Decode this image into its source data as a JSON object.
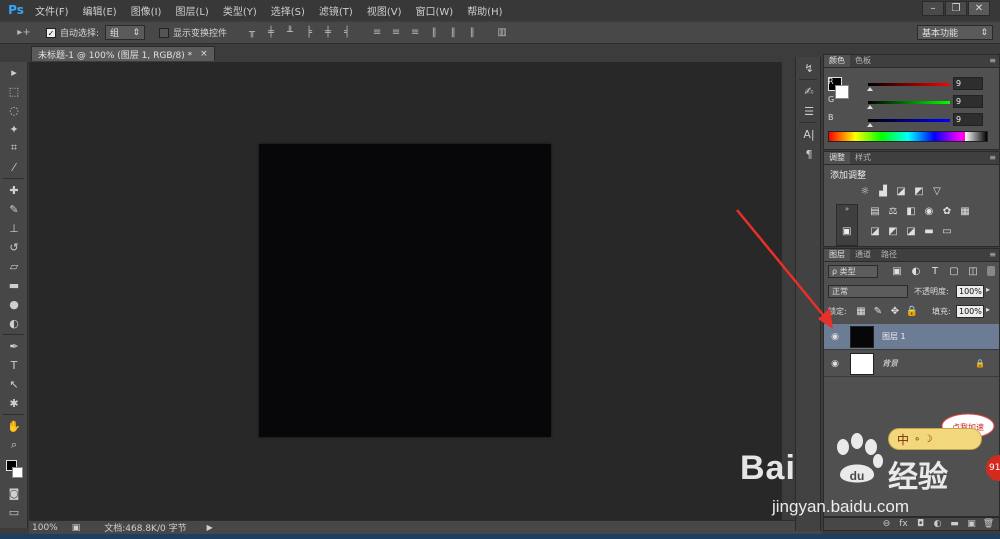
{
  "app": {
    "logo": "Ps"
  },
  "menu": [
    "文件(F)",
    "编辑(E)",
    "图像(I)",
    "图层(L)",
    "类型(Y)",
    "选择(S)",
    "滤镜(T)",
    "视图(V)",
    "窗口(W)",
    "帮助(H)"
  ],
  "window_controls": [
    "–",
    "❐",
    "✕"
  ],
  "options": {
    "tool_glyph": "▸+",
    "auto_select_label": "自动选择:",
    "auto_select_value": "组",
    "show_transform_label": "显示变换控件",
    "workspace": "基本功能"
  },
  "document": {
    "tab_title": "未标题-1 @ 100% (图层 1, RGB/8) *",
    "canvas_color": "#070608"
  },
  "status": {
    "zoom": "100%",
    "doc_info": "文档:468.8K/0 字节"
  },
  "color_panel": {
    "tabs": [
      "颜色",
      "色板"
    ],
    "channels": [
      {
        "label": "R",
        "value": "9",
        "track": "linear-gradient(to right,#000,#ff0000)"
      },
      {
        "label": "G",
        "value": "9",
        "track": "linear-gradient(to right,#000,#00ff00)"
      },
      {
        "label": "B",
        "value": "9",
        "track": "linear-gradient(to right,#000,#0000ff)"
      }
    ]
  },
  "adjust_panel": {
    "tabs": [
      "调整",
      "样式"
    ],
    "heading": "添加调整"
  },
  "layers_panel": {
    "tabs": [
      "图层",
      "通道",
      "路径"
    ],
    "filter_label": "ρ 类型",
    "blend_mode": "正常",
    "opacity_label": "不透明度:",
    "opacity_value": "100%",
    "lock_label": "锁定:",
    "fill_label": "填充:",
    "fill_value": "100%",
    "layers": [
      {
        "name": "图层 1",
        "thumb": "#070608",
        "selected": true,
        "locked": false
      },
      {
        "name": "背景",
        "thumb": "#ffffff",
        "selected": false,
        "locked": true
      }
    ]
  },
  "overlay": {
    "ime_text": "中",
    "ime_extra": "∘ ☽",
    "badge": "91",
    "mascot_text": "点我加速",
    "baidu_logo": "Bai",
    "baidu_cn": "经验",
    "baidu_url": "jingyan.baidu.com"
  }
}
